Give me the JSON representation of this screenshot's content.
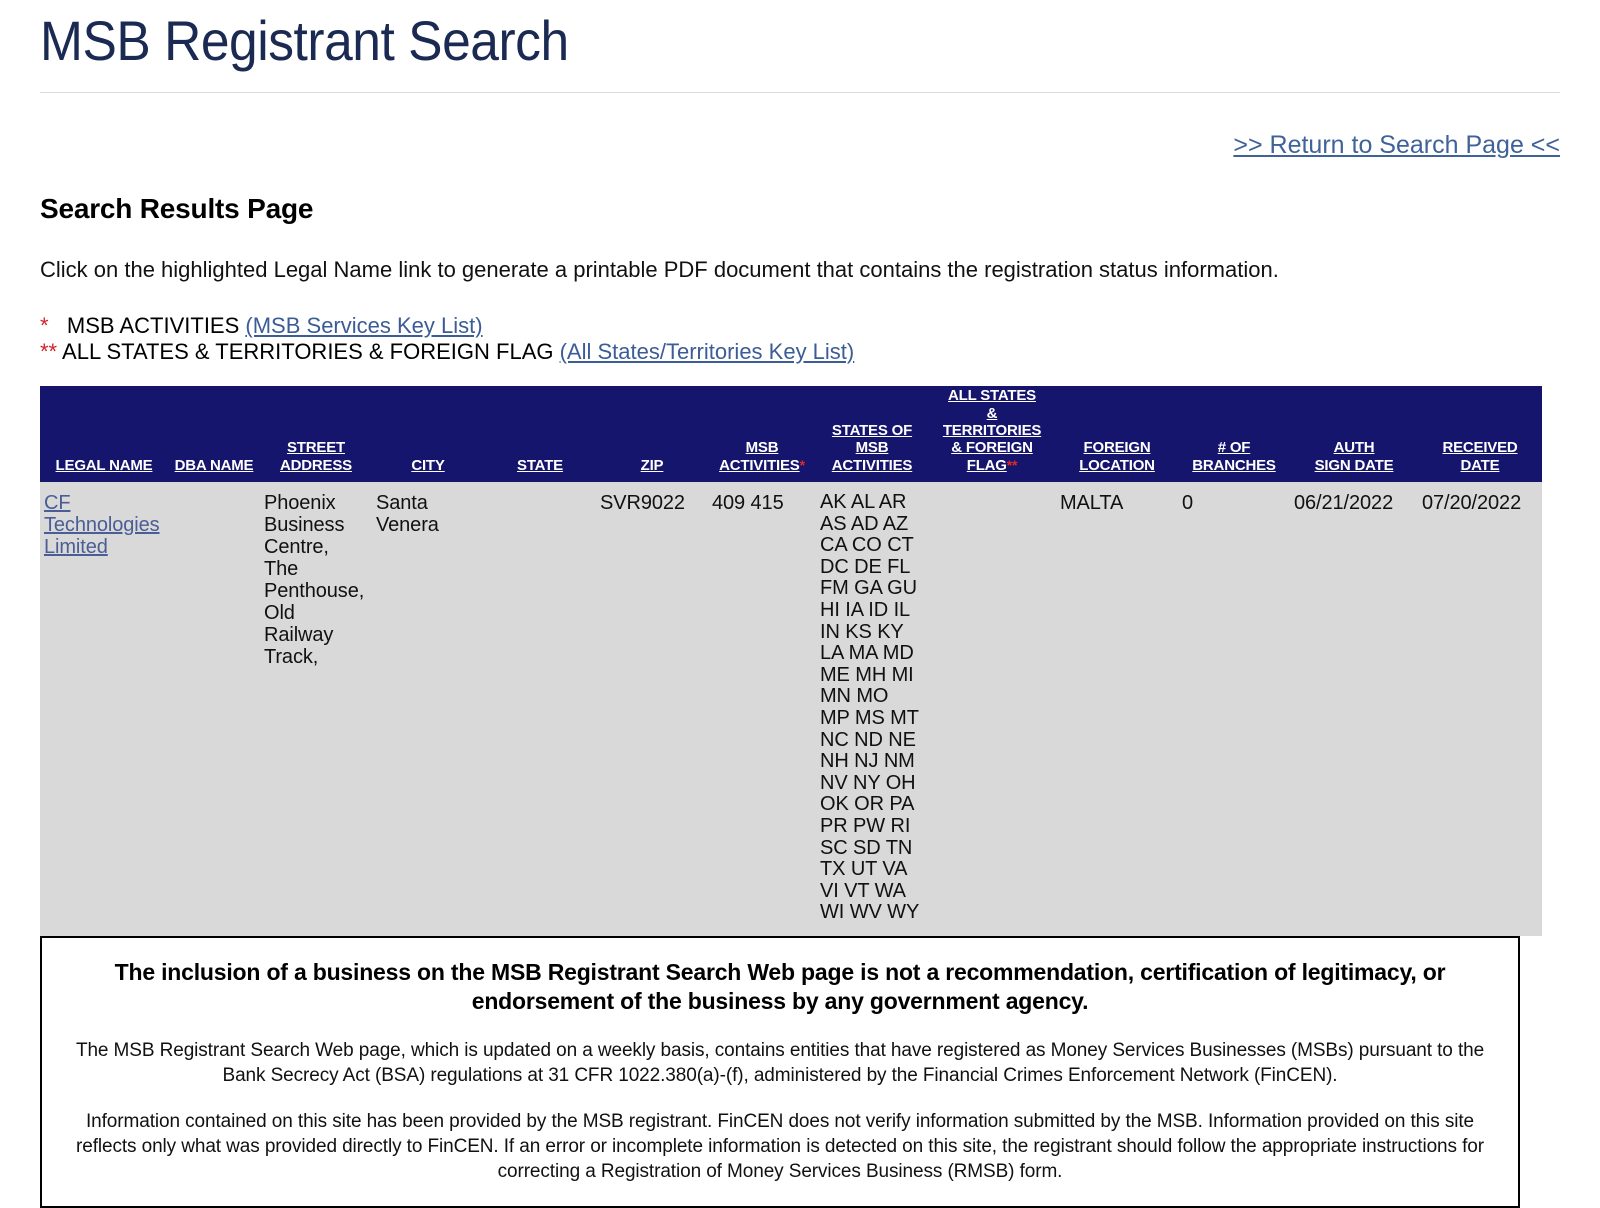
{
  "site": {
    "title": "MSB Registrant Search"
  },
  "nav": {
    "return_link": ">> Return to Search Page <<"
  },
  "intro": {
    "heading": "Search Results Page",
    "instruction": "Click on the highlighted Legal Name link to generate a printable PDF document that contains the registration status information.",
    "key_single_star": "*",
    "key_single_label": "MSB ACTIVITIES",
    "key_single_link": "(MSB Services Key List)",
    "key_double_star": "**",
    "key_double_label": "ALL STATES & TERRITORIES & FOREIGN FLAG",
    "key_double_link": "(All States/Territories Key List)"
  },
  "table": {
    "columns": {
      "legal_name": "LEGAL NAME",
      "dba_name": "DBA NAME",
      "street_address_l1": "STREET",
      "street_address_l2": "ADDRESS",
      "city": "CITY",
      "state": "STATE",
      "zip": "ZIP",
      "msb_activities_l1": "MSB",
      "msb_activities_l2": "ACTIVITIES",
      "msb_activities_star": "*",
      "states_of_msb_l1": "STATES OF",
      "states_of_msb_l2": "MSB",
      "states_of_msb_l3": "ACTIVITIES",
      "all_states_l1": "ALL STATES",
      "all_states_l2": "&",
      "all_states_l3": "TERRITORIES",
      "all_states_l4": "& FOREIGN",
      "all_states_l5": "FLAG",
      "all_states_star": "**",
      "foreign_location_l1": "FOREIGN",
      "foreign_location_l2": "LOCATION",
      "branches_l1": "# OF",
      "branches_l2": "BRANCHES",
      "auth_sign_date_l1": "AUTH",
      "auth_sign_date_l2": "SIGN DATE",
      "received_date_l1": "RECEIVED",
      "received_date_l2": "DATE"
    },
    "rows": [
      {
        "legal_name": "CF Technologies Limited",
        "dba_name": "",
        "street_address": "Phoenix Business Centre, The Penthouse, Old Railway Track,",
        "city": "Santa Venera",
        "state": "",
        "zip": "SVR9022",
        "msb_activities": "409 415",
        "states_of_msb_activities": "AK AL AR AS AD AZ CA CO CT DC DE FL FM GA GU HI IA ID IL IN KS KY LA MA MD ME MH MI MN MO MP MS MT NC ND NE NH NJ NM NV NY OH OK OR PA PR PW RI SC SD TN TX UT VA VI VT WA WI WV WY",
        "all_states_territories_foreign_flag": "",
        "foreign_location": "MALTA",
        "num_branches": "0",
        "auth_sign_date": "06/21/2022",
        "received_date": "07/20/2022"
      }
    ]
  },
  "disclaimer": {
    "heading": "The inclusion of a business on the MSB Registrant Search Web page is not a recommendation, certification of legitimacy, or endorsement of the business by any government agency.",
    "paragraph_1": "The MSB Registrant Search Web page, which is updated on a weekly basis, contains entities that have registered as Money Services Businesses (MSBs) pursuant to the Bank Secrecy Act (BSA) regulations at 31 CFR 1022.380(a)-(f), administered by the Financial Crimes Enforcement Network (FinCEN).",
    "paragraph_2": "Information contained on this site has been provided by the MSB registrant. FinCEN does not verify information submitted by the MSB. Information provided on this site reflects only what was provided directly to FinCEN. If an error or incomplete information is detected on this site, the registrant should follow the appropriate instructions for correcting a Registration of Money Services Business (RMSB) form."
  },
  "colors": {
    "header_navy": "#15156d",
    "title_navy": "#1b2a52",
    "link_blue": "#3f6299",
    "row_gray": "#d9d9d9",
    "asterisk_red": "#d2232a"
  }
}
